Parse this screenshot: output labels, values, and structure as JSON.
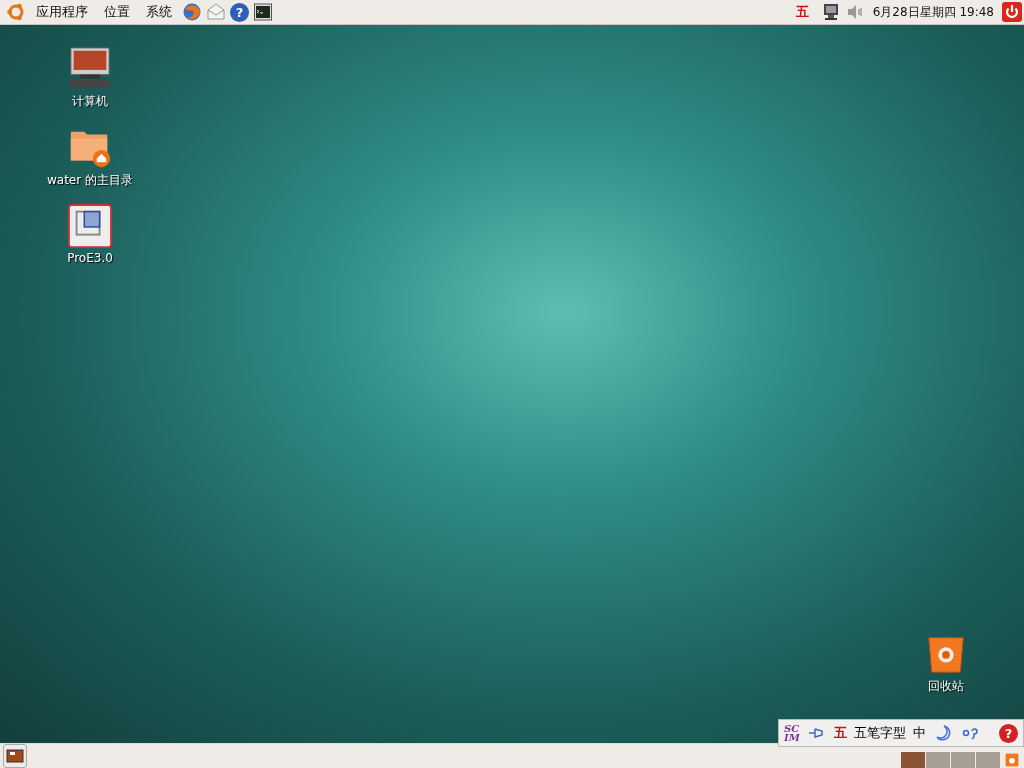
{
  "top_panel": {
    "menus": [
      {
        "label": "应用程序"
      },
      {
        "label": "位置"
      },
      {
        "label": "系统"
      }
    ],
    "help_glyph": "?",
    "ime_indicator": "五",
    "clock": "6月28日星期四 19:48"
  },
  "desktop": {
    "icons": [
      {
        "kind": "computer",
        "label": "计算机"
      },
      {
        "kind": "home",
        "label": "water 的主目录"
      },
      {
        "kind": "app",
        "label": "ProE3.0"
      }
    ],
    "trash_label": "回收站"
  },
  "scim_toolbar": {
    "logo": [
      "SC",
      "IM"
    ],
    "mode_glyph": "五",
    "input_method": "五笔字型",
    "language": "中",
    "help_glyph": "?"
  },
  "bottom_panel": {
    "workspaces": [
      {
        "selected": true
      },
      {
        "selected": false
      },
      {
        "selected": false
      },
      {
        "selected": false
      }
    ]
  }
}
